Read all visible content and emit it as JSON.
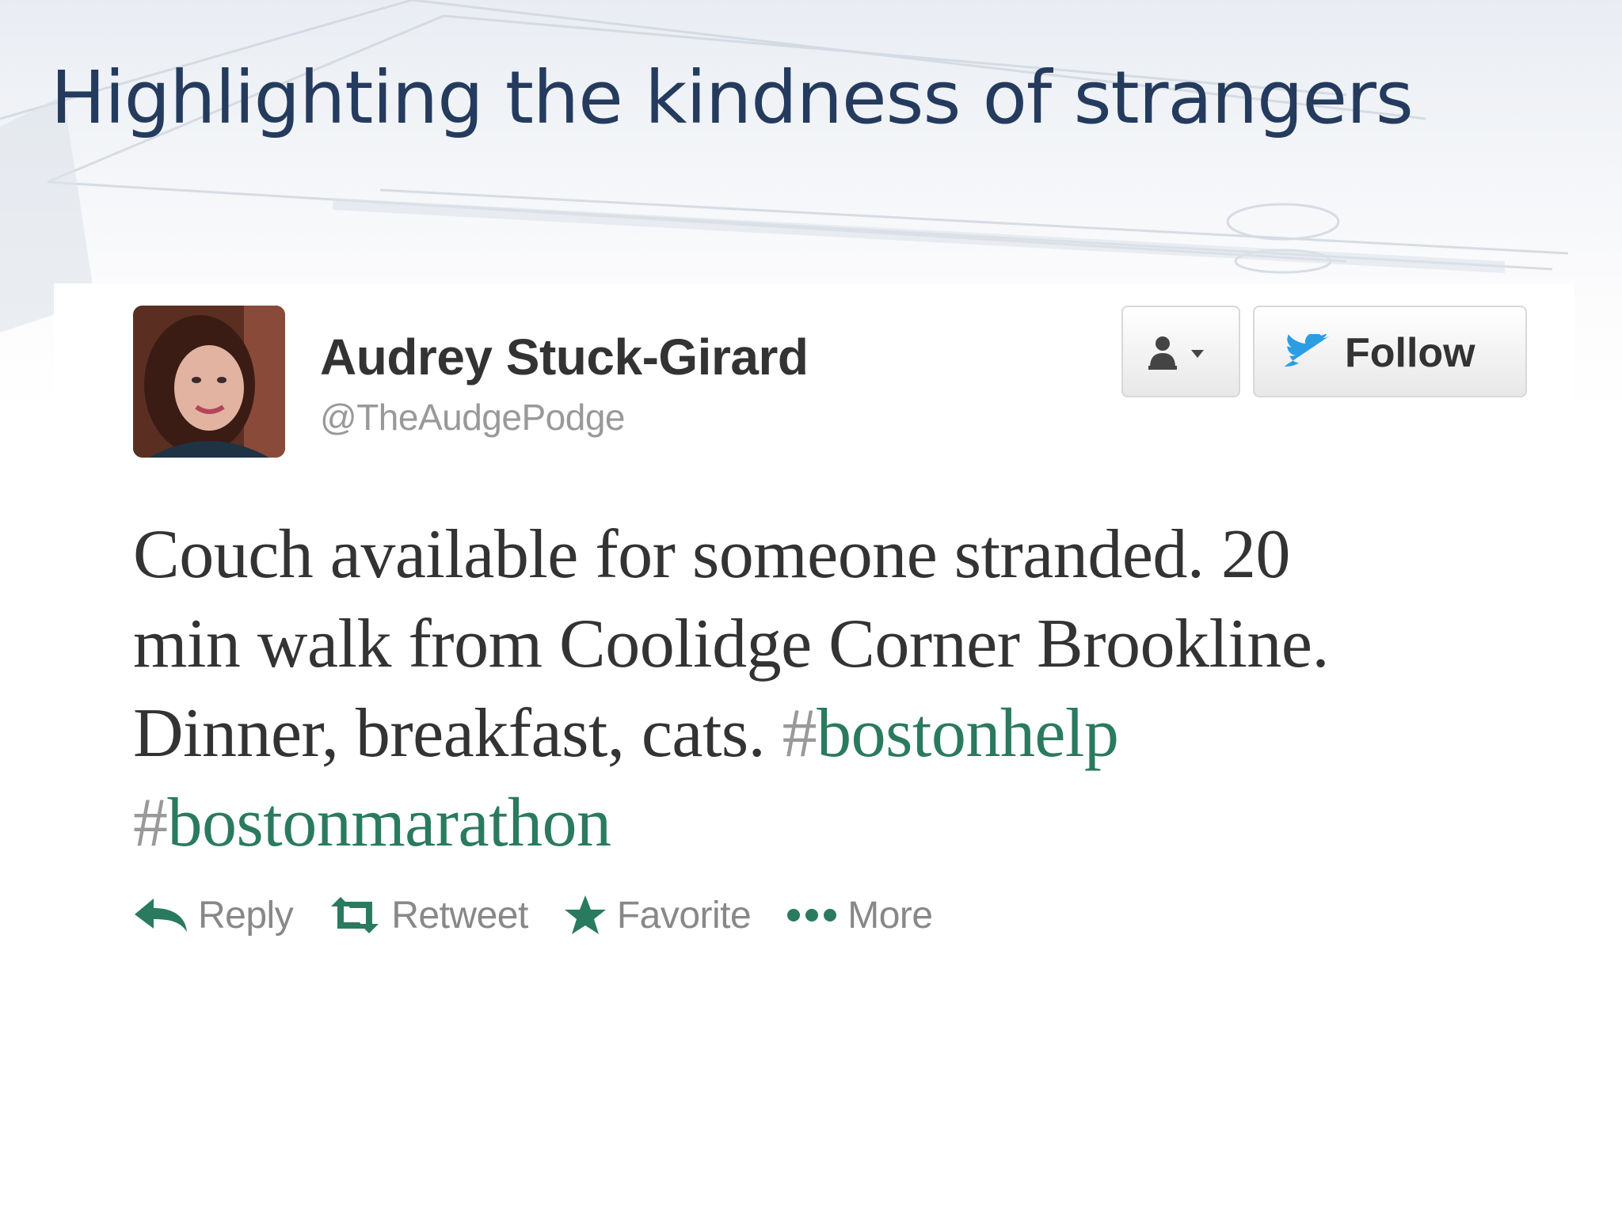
{
  "slide": {
    "title": "Highlighting the kindness of strangers"
  },
  "tweet": {
    "user": {
      "display_name": "Audrey Stuck-Girard",
      "handle": "@TheAudgePodge"
    },
    "buttons": {
      "user_actions_icon": "person-dropdown-icon",
      "follow_label": "Follow"
    },
    "text": {
      "line1": "Couch available for someone stranded. 20",
      "line2": "min walk from Coolidge Corner Brookline.",
      "line3_text": "Dinner, breakfast, cats. ",
      "hashtag1_mark": "#",
      "hashtag1": "bostonhelp",
      "hashtag2_mark": "#",
      "hashtag2": "bostonmarathon"
    },
    "actions": [
      {
        "label": "Reply",
        "icon": "reply-arrow-icon"
      },
      {
        "label": "Retweet",
        "icon": "retweet-icon"
      },
      {
        "label": "Favorite",
        "icon": "star-icon"
      },
      {
        "label": "More",
        "icon": "ellipsis-icon"
      }
    ],
    "colors": {
      "accent_green": "#2a7a5f",
      "title_blue": "#243b5e",
      "text_dark": "#333333",
      "text_muted": "#999999"
    }
  }
}
